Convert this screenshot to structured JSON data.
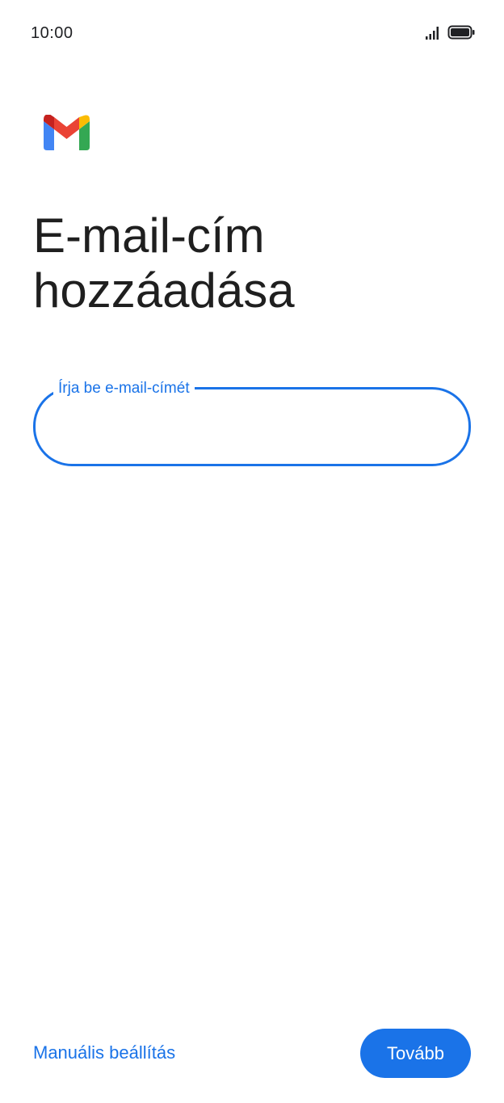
{
  "status_bar": {
    "time": "10:00",
    "icons": [
      "signal-icon",
      "battery-icon"
    ]
  },
  "header": {
    "logo": "gmail-logo",
    "title": "E-mail-cím hozzáadása"
  },
  "form": {
    "email_label": "Írja be e-mail-címét",
    "email_value": ""
  },
  "footer": {
    "manual_setup_label": "Manuális beállítás",
    "next_label": "Tovább"
  },
  "colors": {
    "accent": "#1a73e8",
    "text": "#1f1f1f",
    "background": "#ffffff"
  }
}
